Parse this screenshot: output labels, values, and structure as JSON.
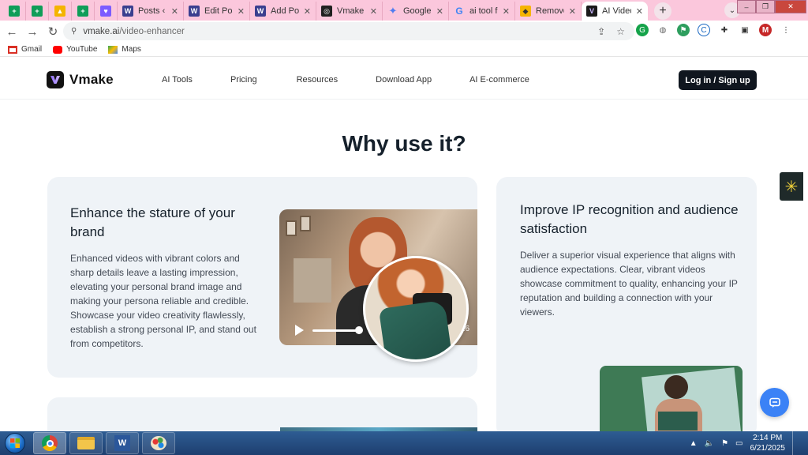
{
  "browser": {
    "tabs": [
      {
        "title": "",
        "icon": "sheets-icon",
        "color": "#0f9d58"
      },
      {
        "title": "",
        "icon": "sheets-icon",
        "color": "#0f9d58"
      },
      {
        "title": "",
        "icon": "photos-icon",
        "color": "#f4b400"
      },
      {
        "title": "",
        "icon": "sheets-icon",
        "color": "#0f9d58"
      },
      {
        "title": "",
        "icon": "chat-icon",
        "color": "#7b5cff"
      },
      {
        "title": "Posts ‹ ai",
        "icon": "wordpress-icon",
        "color": "#3a3f8f"
      },
      {
        "title": "Edit Post",
        "icon": "wordpress-icon",
        "color": "#3a3f8f"
      },
      {
        "title": "Add Post",
        "icon": "wordpress-icon",
        "color": "#3a3f8f"
      },
      {
        "title": "Vmake AI",
        "icon": "openai-icon",
        "color": "#202020"
      },
      {
        "title": "Google G",
        "icon": "gemini-icon",
        "color": "#4f7cf0"
      },
      {
        "title": "ai tool for",
        "icon": "google-icon",
        "color": "#ffffff"
      },
      {
        "title": "Remove B",
        "icon": "remove-bg-icon",
        "color": "#f5b400"
      },
      {
        "title": "AI Video E",
        "icon": "vmake-icon",
        "color": "#1a1a1a"
      }
    ],
    "url": "vmake.ai/video-enhancer",
    "url_host": "vmake.ai",
    "url_path": "/video-enhancer",
    "profile_initial": "M",
    "bookmarks": [
      {
        "label": "Gmail",
        "icon": "gmail-icon"
      },
      {
        "label": "YouTube",
        "icon": "youtube-icon"
      },
      {
        "label": "Maps",
        "icon": "maps-icon"
      }
    ]
  },
  "site": {
    "brand": "Vmake",
    "nav": [
      "AI Tools",
      "Pricing",
      "Resources",
      "Download App",
      "AI E-commerce"
    ],
    "login_label": "Log in / Sign up"
  },
  "section": {
    "title": "Why use it?",
    "card1": {
      "title": "Enhance the stature of your brand",
      "text": "Enhanced videos with vibrant colors and sharp details leave a lasting impression, elevating your personal brand image and making your persona reliable and credible. Showcase your video creativity flawlessly, establish a strong personal IP, and stand out from competitors.",
      "video_time": "26",
      "video_progress": 0.4
    },
    "card2": {
      "title": "Improve IP recognition and audience satisfaction",
      "text": "Deliver a superior visual experience that aligns with audience expectations. Clear, vibrant videos showcase commitment to quality, enhancing your IP reputation and building a connection with your viewers."
    }
  },
  "taskbar": {
    "time": "2:14 PM",
    "date": "6/21/2025",
    "apps": [
      "chrome-icon",
      "explorer-icon",
      "word-icon",
      "paint-icon"
    ]
  }
}
